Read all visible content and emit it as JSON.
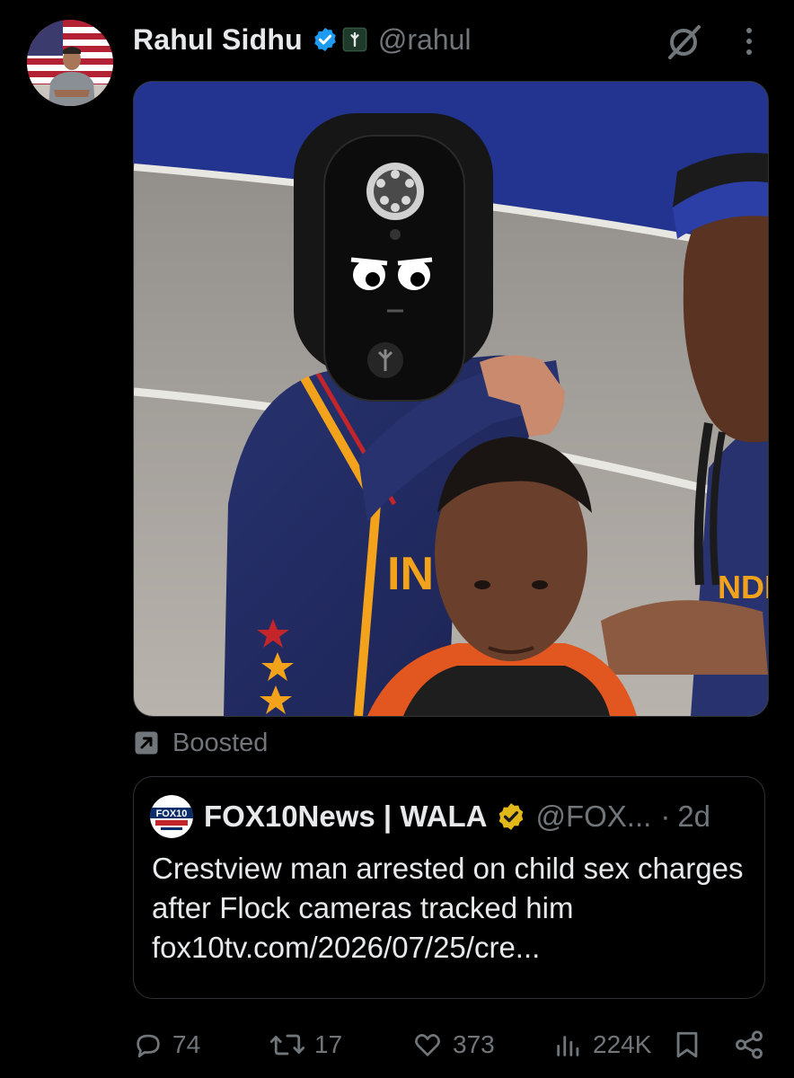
{
  "post": {
    "author_name": "Rahul Sidhu",
    "author_handle": "@rahul"
  },
  "boost_label": "Boosted",
  "quote": {
    "source_name": "FOX10News | WALA",
    "source_handle": "@FOX...",
    "separator": "·",
    "time": "2d",
    "text": "Crestview man arrested on child sex charges after Flock cameras tracked him fox10tv.com/2026/07/25/cre...",
    "logo_text": "FOX10"
  },
  "actions": {
    "replies": "74",
    "reposts": "17",
    "likes": "373",
    "views": "224K"
  },
  "colors": {
    "background": "#000000",
    "text": "#e7e9ea",
    "muted": "#71767b",
    "verified_blue": "#1d9bf0",
    "verified_gold": "#e2b719",
    "border": "#2f3336"
  },
  "icons": [
    "verified-badge-icon",
    "affiliate-badge-icon",
    "grok-icon",
    "more-options-icon",
    "boost-arrow-icon",
    "reply-icon",
    "repost-icon",
    "like-icon",
    "views-icon",
    "bookmark-icon",
    "share-icon"
  ]
}
